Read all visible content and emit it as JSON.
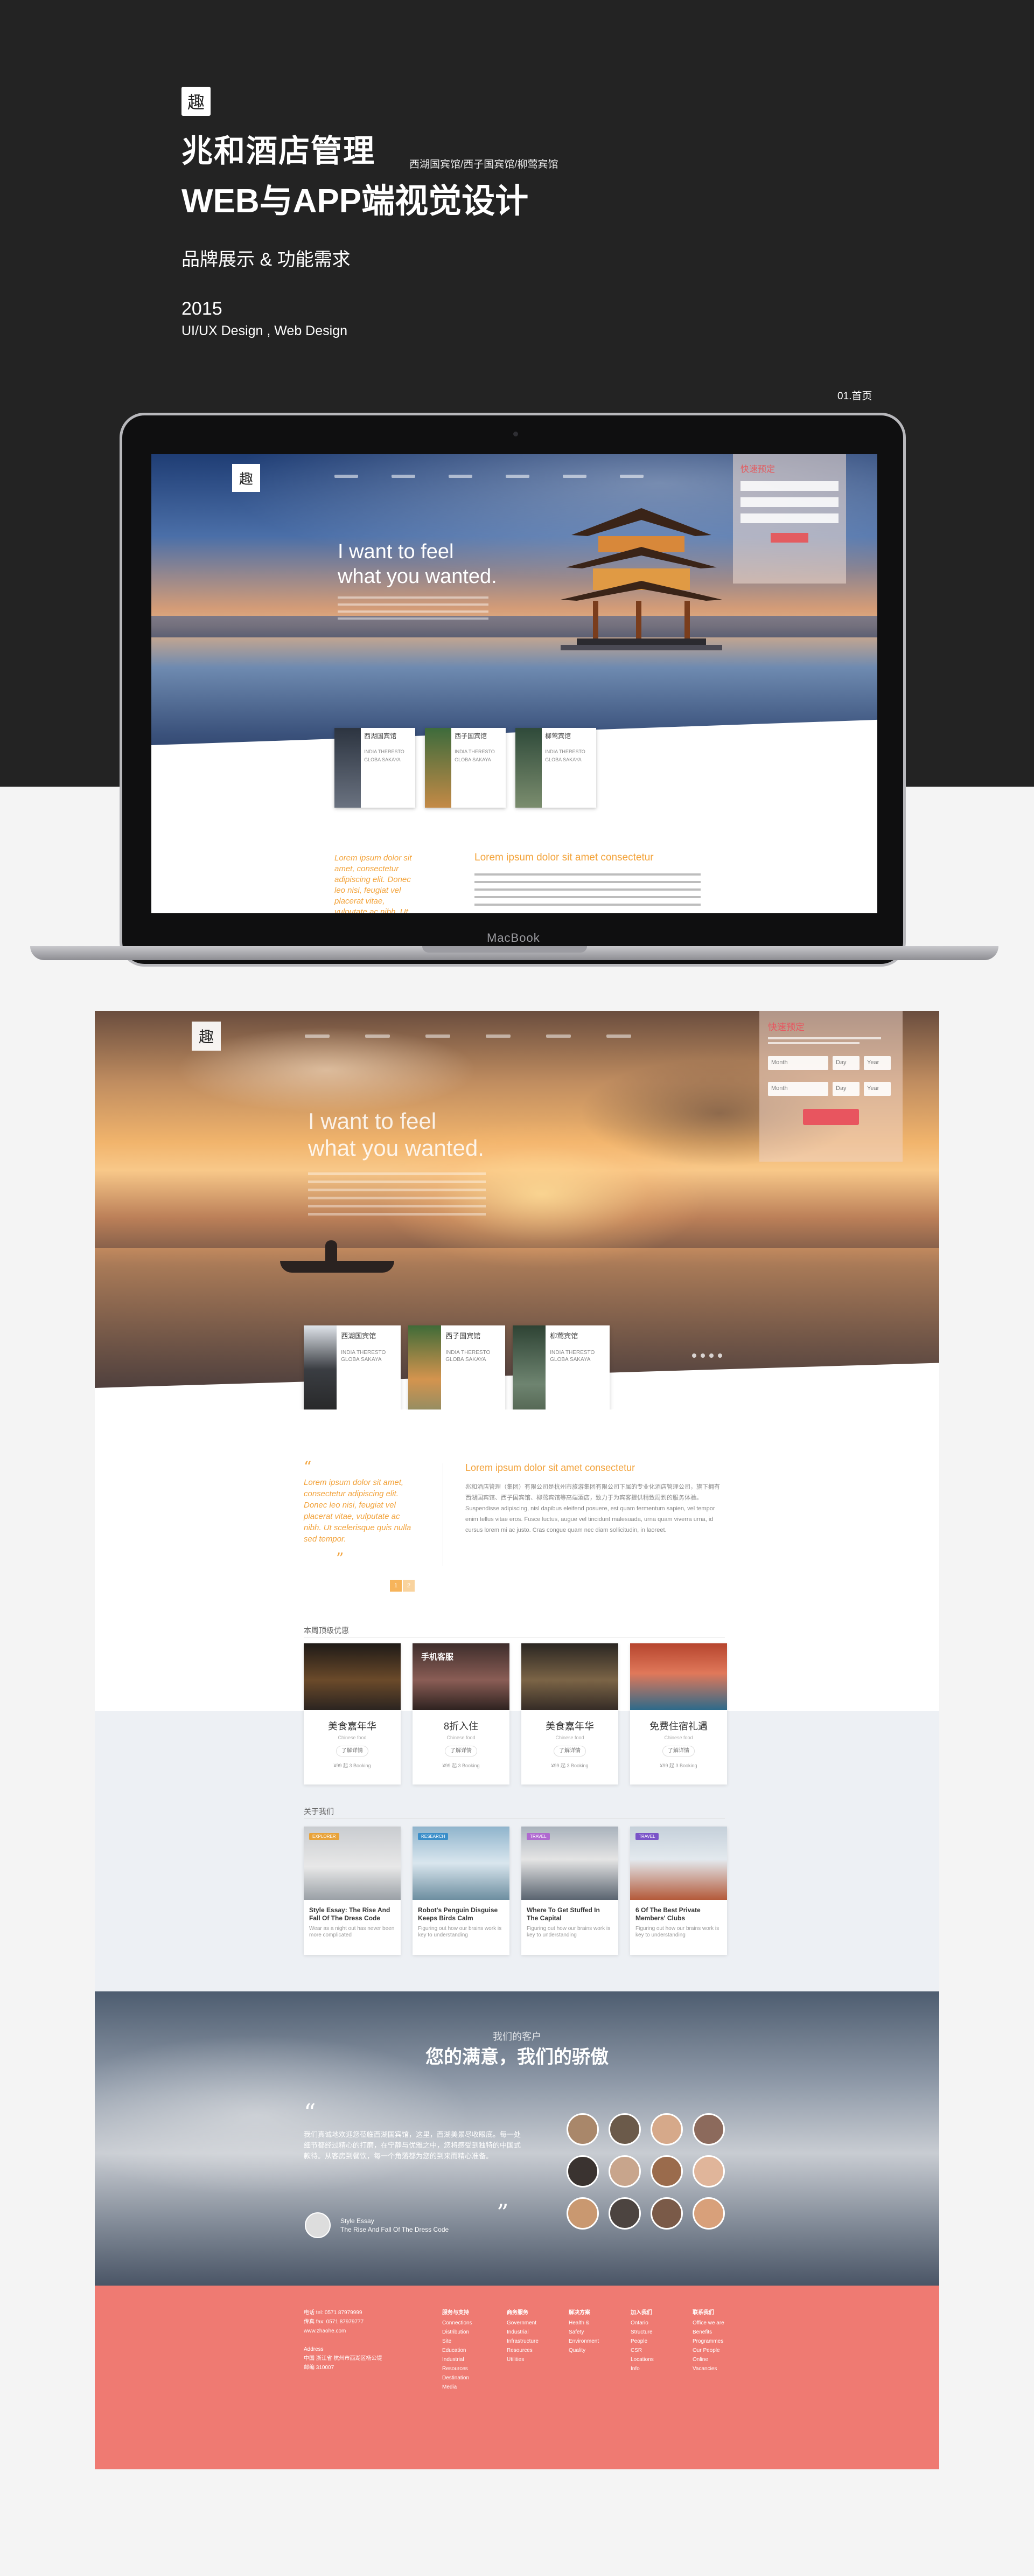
{
  "intro": {
    "logo_char": "趣",
    "title": "兆和酒店管理",
    "title_side": "西湖国宾馆/西子国宾馆/柳莺宾馆",
    "subtitle": "WEB与APP端视觉设计",
    "tagline": "品牌展示 & 功能需求",
    "year": "2015",
    "role": "UI/UX Design , Web Design",
    "page_label": "01.首页"
  },
  "laptop": {
    "brand": "MacBook",
    "headline_1": "I want to feel",
    "headline_2": "what you wanted.",
    "booking_title": "快速预定",
    "cards": [
      {
        "name": "西湖国宾馆",
        "en": "INDIA THERESTO GLOBA SAKAYA"
      },
      {
        "name": "西子国宾馆",
        "en": "INDIA THERESTO GLOBA SAKAYA"
      },
      {
        "name": "柳莺宾馆",
        "en": "INDIA THERESTO GLOBA SAKAYA"
      }
    ],
    "quote": "Lorem ipsum dolor sit amet, consectetur adipiscing elit. Donec leo nisi, feugiat vel placerat vitae, vulputate ac nibh. Ut scelerisque quis nulla sed tempor.",
    "body_title": "Lorem ipsum dolor sit amet consectetur"
  },
  "site": {
    "logo_char": "趣",
    "headline_1": "I want to feel",
    "headline_2": "what you wanted.",
    "booking": {
      "title": "快速预定",
      "f1": "Month",
      "f2": "Day",
      "f3": "Year",
      "f4": "Month",
      "f5": "Day",
      "f6": "Year"
    },
    "cards": [
      {
        "name": "西湖国宾馆",
        "en": "INDIA THERESTO GLOBA SAKAYA"
      },
      {
        "name": "西子国宾馆",
        "en": "INDIA THERESTO GLOBA SAKAYA"
      },
      {
        "name": "柳莺宾馆",
        "en": "INDIA THERESTO GLOBA SAKAYA"
      }
    ],
    "quote": "Lorem ipsum dolor sit amet, consectetur adipiscing elit. Donec leo nisi, feugiat vel placerat vitae, vulputate ac nibh. Ut scelerisque quis nulla sed tempor.",
    "body_title": "Lorem ipsum dolor sit amet consectetur",
    "body_text": "兆和酒店管理（集团）有限公司是杭州市旅游集团有限公司下属的专业化酒店管理公司，旗下拥有西湖国宾馆、西子国宾馆、柳莺宾馆等高端酒店，致力于为宾客提供精致周到的服务体验。Suspendisse adipiscing, nisl dapibus eleifend posuere, est quam fermentum sapien, vel tempor enim tellus vitae eros. Fusce luctus, augue vel tincidunt malesuada, urna quam viverra urna, id cursus lorem mi ac justo. Cras congue quam nec diam sollicitudin, in laoreet.",
    "pager": [
      "1",
      "2"
    ],
    "deals_title": "本周顶级优惠",
    "deals": [
      {
        "name": "美食嘉年华",
        "en": "Chinese food",
        "btn": "了解详情",
        "meta": "¥99 起 3 Booking",
        "overlay": ""
      },
      {
        "name": "8折入住",
        "en": "Chinese food",
        "btn": "了解详情",
        "meta": "¥99 起 3 Booking",
        "overlay": "手机客服"
      },
      {
        "name": "美食嘉年华",
        "en": "Chinese food",
        "btn": "了解详情",
        "meta": "¥99 起 3 Booking",
        "overlay": ""
      },
      {
        "name": "免费住宿礼遇",
        "en": "Chinese food",
        "btn": "了解详情",
        "meta": "¥99 起 3 Booking",
        "overlay": ""
      }
    ],
    "about_title": "关于我们",
    "posts": [
      {
        "tag": "EXPLORER",
        "title": "Style Essay: The Rise And Fall Of The Dress Code",
        "desc": "Wear as a night out has never been more complicated"
      },
      {
        "tag": "RESEARCH",
        "title": "Robot's Penguin Disguise Keeps Birds Calm",
        "desc": "Figuring out how our brains work is key to understanding"
      },
      {
        "tag": "TRAVEL",
        "title": "Where To Get Stuffed In The Capital",
        "desc": "Figuring out how our brains work is key to understanding"
      },
      {
        "tag": "TRAVEL",
        "title": "6 Of The Best Private Members' Clubs",
        "desc": "Figuring out how our brains work is key to understanding"
      }
    ],
    "testimonial": {
      "caption": "我们的客户",
      "title": "您的满意，我们的骄傲",
      "text": "我们真诚地欢迎您莅临西湖国宾馆，这里，西湖美景尽收眼底。每一处细节都经过精心的打磨，在宁静与优雅之中，您将感受到独特的中国式款待。从客房到餐饮，每一个角落都为您的到来而精心准备。",
      "author_1": "Style Essay",
      "author_2": "The Rise And Fall Of The Dress Code"
    },
    "footer": {
      "c1": [
        "电话 tel: 0571 87979999",
        "传真 fax: 0571 87979777",
        "www.zhaohe.com",
        "",
        "Address",
        "中国 浙江省 杭州市西湖区杨公堤",
        "邮编 310007"
      ],
      "c2_head": "服务与支持",
      "c2": [
        "Connections",
        "Distribution",
        "Site",
        "Education",
        "Industrial",
        "Resources",
        "Destination",
        "Media"
      ],
      "c3_head": "商务服务",
      "c3": [
        "Government",
        "Industrial",
        "Infrastructure",
        "Resources",
        "Utilities"
      ],
      "c4_head": "解决方案",
      "c4": [
        "Health &",
        "Safety",
        "Environment",
        "Quality"
      ],
      "c5_head": "加入我们",
      "c5": [
        "Ontario",
        "Structure",
        "People",
        "CSR",
        "Locations",
        "Info"
      ],
      "c6_head": "联系我们",
      "c6": [
        "Office we are",
        "Benefits",
        "Programmes",
        "Our People",
        "Online",
        "Vacancies"
      ]
    }
  }
}
